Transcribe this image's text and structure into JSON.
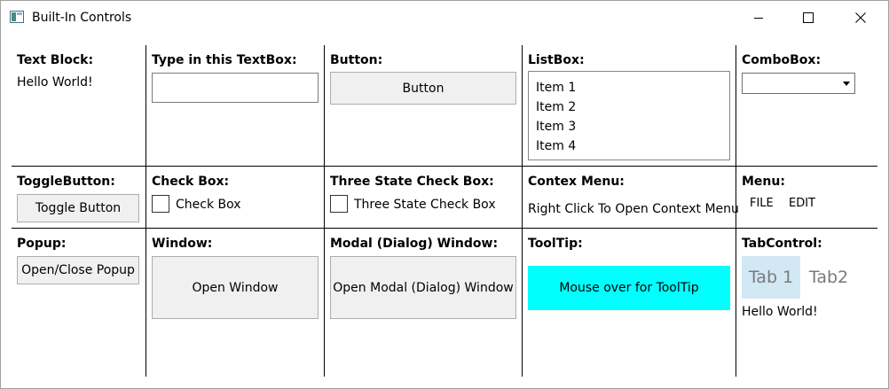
{
  "window": {
    "title": "Built-In Controls"
  },
  "controls": {
    "textblock": {
      "label": "Text Block:",
      "text": "Hello World!"
    },
    "textbox": {
      "label": "Type in this TextBox:",
      "value": ""
    },
    "button": {
      "label": "Button:",
      "button_text": "Button"
    },
    "listbox": {
      "label": "ListBox:",
      "items": [
        "Item 1",
        "Item 2",
        "Item 3",
        "Item 4"
      ]
    },
    "combobox": {
      "label": "ComboBox:",
      "value": ""
    },
    "togglebutton": {
      "label": "ToggleButton:",
      "button_text": "Toggle Button"
    },
    "checkbox": {
      "label": "Check Box:",
      "text": "Check Box"
    },
    "threestate": {
      "label": "Three State Check Box:",
      "text": "Three State Check Box"
    },
    "contextmenu": {
      "label": "Contex Menu:",
      "text": "Right Click To Open Context Menu"
    },
    "menu": {
      "label": "Menu:",
      "items": [
        "FILE",
        "EDIT"
      ]
    },
    "popup": {
      "label": "Popup:",
      "button_text": "Open/Close Popup"
    },
    "window_ctl": {
      "label": "Window:",
      "button_text": "Open Window"
    },
    "modal": {
      "label": "Modal (Dialog) Window:",
      "button_text": "Open Modal (Dialog) Window"
    },
    "tooltip": {
      "label": "ToolTip:",
      "text": "Mouse over for ToolTip",
      "color": "#00ffff"
    },
    "tabcontrol": {
      "label": "TabControl:",
      "tabs": [
        "Tab 1",
        "Tab2"
      ],
      "content": "Hello World!"
    }
  },
  "colors": {
    "tab_active": "#d2e8f5",
    "button_bg": "#f0f0f0"
  }
}
